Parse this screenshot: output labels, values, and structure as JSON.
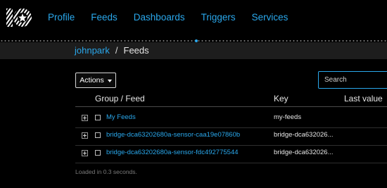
{
  "nav": {
    "items": [
      "Profile",
      "Feeds",
      "Dashboards",
      "Triggers",
      "Services"
    ]
  },
  "breadcrumb": {
    "user": "johnpark",
    "separator": "/",
    "current": "Feeds"
  },
  "toolbar": {
    "actions_label": "Actions",
    "search_placeholder": "Search"
  },
  "table": {
    "headers": {
      "group_feed": "Group / Feed",
      "key": "Key",
      "last_value": "Last value"
    },
    "rows": [
      {
        "name": "My Feeds",
        "key": "my-feeds"
      },
      {
        "name": "bridge-dca63202680a-sensor-caa19e07860b",
        "key": "bridge-dca632026..."
      },
      {
        "name": "bridge-dca63202680a-sensor-fdc492775544",
        "key": "bridge-dca632026..."
      }
    ]
  },
  "status": "Loaded in 0.3 seconds.",
  "colors": {
    "accent": "#2aa8ec",
    "background": "#000000",
    "breadcrumb_bar": "#1d1d1d"
  }
}
